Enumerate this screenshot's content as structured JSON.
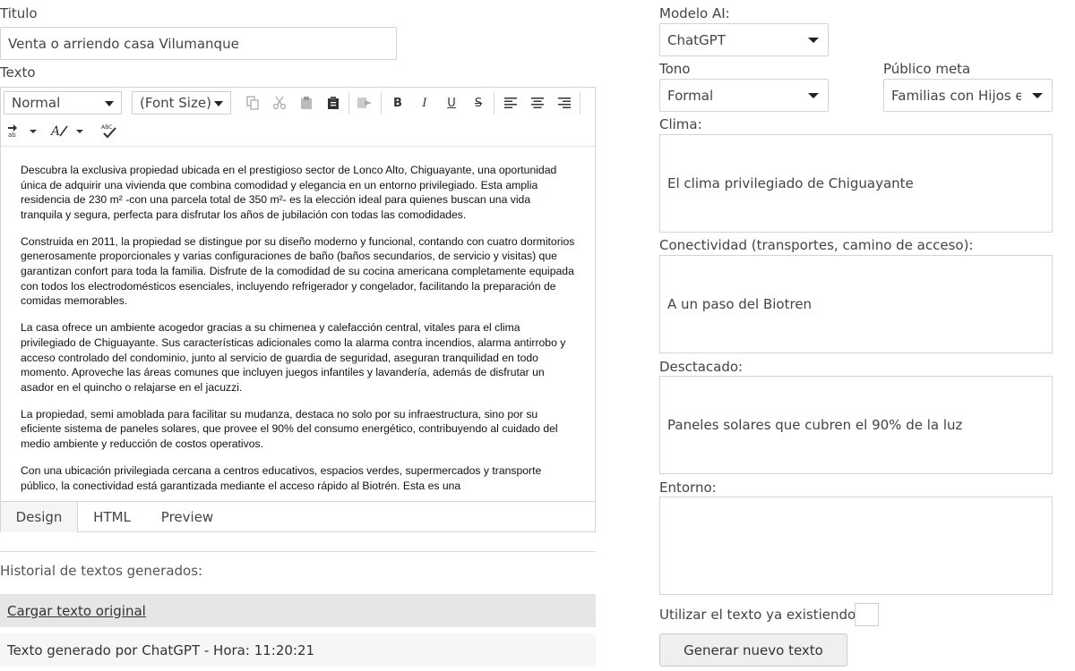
{
  "left": {
    "title_label": "Titulo",
    "title_value": "Venta o arriendo casa Vilumanque",
    "text_label": "Texto",
    "toolbar": {
      "format_select": "Normal",
      "font_size_select": "(Font Size)",
      "bold": "B",
      "italic": "I",
      "underline": "U",
      "strike": "S"
    },
    "content": {
      "paragraphs": [
        "Descubra la exclusiva propiedad ubicada en el prestigioso sector de Lonco Alto, Chiguayante, una oportunidad única de adquirir una vivienda que combina comodidad y elegancia en un entorno privilegiado. Esta amplia residencia de 230 m² -con una parcela total de 350 m²- es la elección ideal para quienes buscan una vida tranquila y segura, perfecta para disfrutar los años de jubilación con todas las comodidades.",
        "Construida en 2011, la propiedad se distingue por su diseño moderno y funcional, contando con cuatro dormitorios generosamente proporcionales y varias configuraciones de baño (baños secundarios, de servicio y visitas) que garantizan confort para toda la familia. Disfrute de la comodidad de su cocina americana completamente equipada con todos los electrodomésticos esenciales, incluyendo refrigerador y congelador, facilitando la preparación de comidas memorables.",
        "La casa ofrece un ambiente acogedor gracias a su chimenea y calefacción central, vitales para el clima privilegiado de Chiguayante. Sus características adicionales como la alarma contra incendios, alarma antirrobo y acceso controlado del condominio, junto al servicio de guardia de seguridad, aseguran tranquilidad en todo momento. Aproveche las áreas comunes que incluyen juegos infantiles y lavandería, además de disfrutar un asador en el quincho o relajarse en el jacuzzi.",
        "La propiedad, semi amoblada para facilitar su mudanza, destaca no solo por su infraestructura, sino por su eficiente sistema de paneles solares, que provee el 90% del consumo energético, contribuyendo al cuidado del medio ambiente y reducción de costos operativos.",
        "Con una ubicación privilegiada cercana a centros educativos, espacios verdes, supermercados y transporte público, la conectividad está garantizada mediante el acceso rápido al Biotrén. Esta es una"
      ]
    },
    "tabs": [
      "Design",
      "HTML",
      "Preview"
    ],
    "history_label": "Historial de textos generados:",
    "history_items": [
      "Cargar texto original",
      "Texto generado por ChatGPT - Hora: 11:20:21"
    ]
  },
  "right": {
    "model_label": "Modelo AI:",
    "model_value": "ChatGPT",
    "tone_label": "Tono",
    "tone_value": "Formal",
    "audience_label": "Público meta",
    "audience_value": "Familias con Hijos e",
    "climate_label": "Clima:",
    "climate_value": "El clima privilegiado de Chiguayante",
    "connectivity_label": "Conectividad (transportes, camino de acceso):",
    "connectivity_value": "A un paso del Biotren",
    "highlight_label": "Desctacado:",
    "highlight_value": "Paneles solares que cubren el 90% de la luz",
    "environment_label": "Entorno:",
    "environment_value": "",
    "use_existing_label": "Utilizar el texto ya existiendo:",
    "use_existing_checked": false,
    "generate_button": "Generar nuevo texto"
  },
  "colors": {
    "border": "#d4d4d4",
    "active_tab_bg": "#f5f5f5",
    "history_highlight_bg": "#e6e6e6",
    "history_bg": "#f6f6f6",
    "button_bg": "#efefef"
  }
}
